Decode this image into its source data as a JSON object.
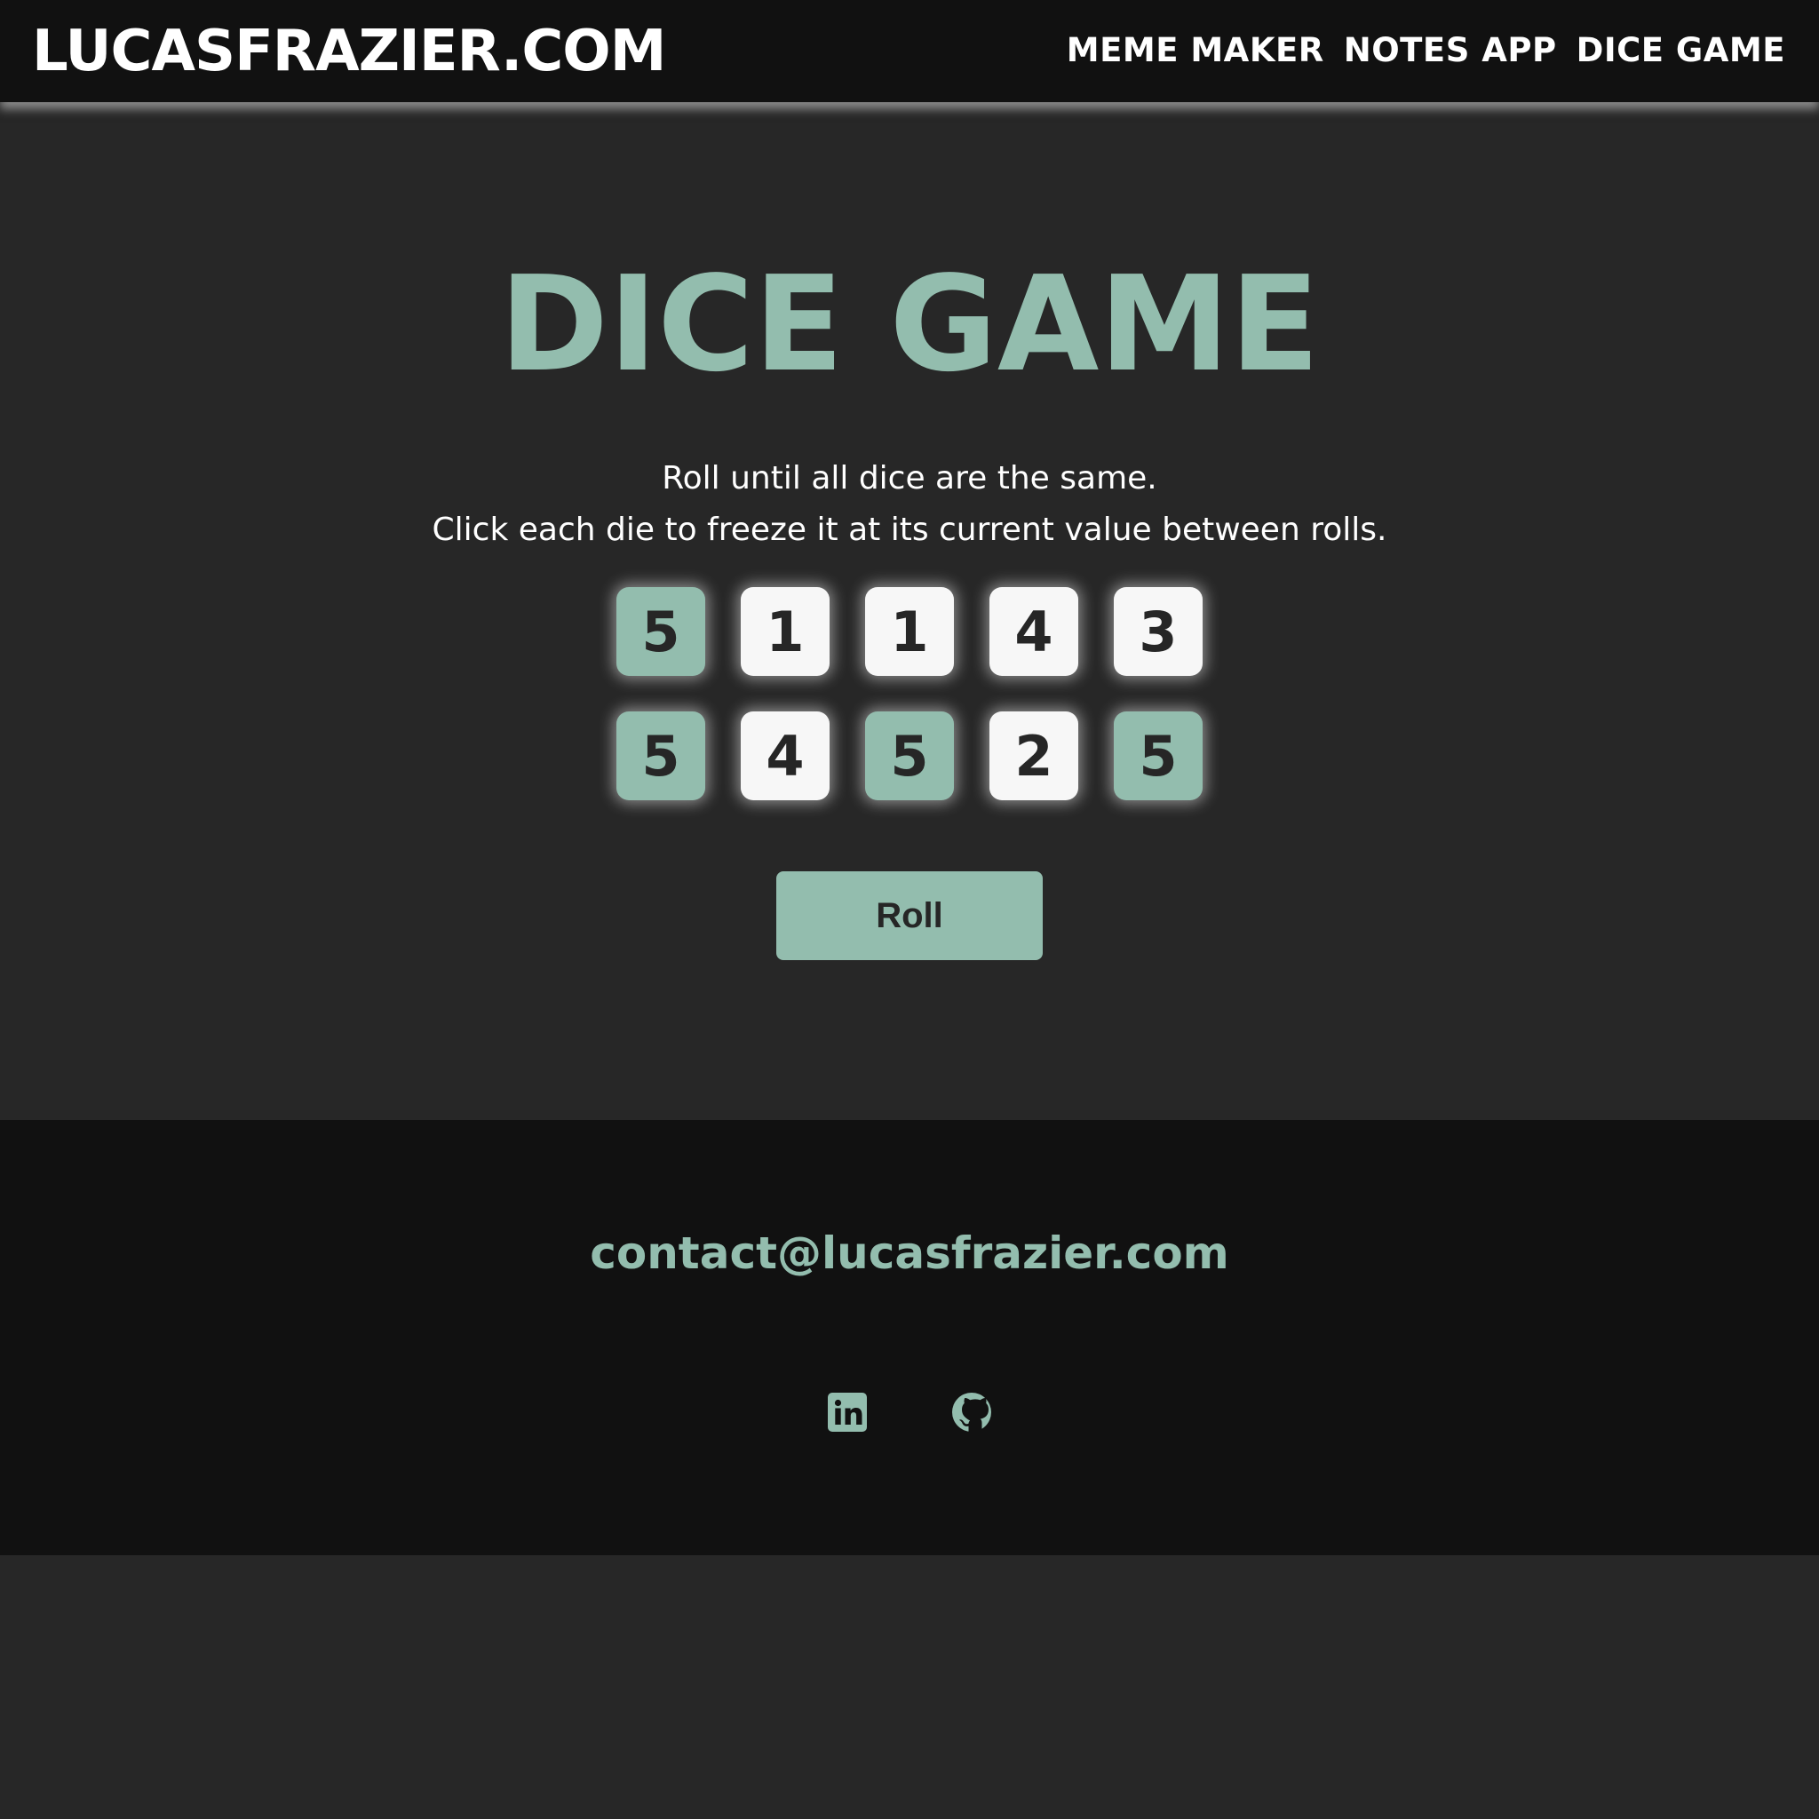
{
  "header": {
    "brand": "LUCASFRAZIER.COM",
    "nav": [
      {
        "label": "MEME MAKER"
      },
      {
        "label": "NOTES APP"
      },
      {
        "label": "DICE GAME"
      }
    ]
  },
  "main": {
    "title": "DICE GAME",
    "instructions": [
      "Roll until all dice are the same.",
      "Click each die to freeze it at its current value between rolls."
    ],
    "dice": [
      {
        "value": "5",
        "held": true
      },
      {
        "value": "1",
        "held": false
      },
      {
        "value": "1",
        "held": false
      },
      {
        "value": "4",
        "held": false
      },
      {
        "value": "3",
        "held": false
      },
      {
        "value": "5",
        "held": true
      },
      {
        "value": "4",
        "held": false
      },
      {
        "value": "5",
        "held": true
      },
      {
        "value": "2",
        "held": false
      },
      {
        "value": "5",
        "held": true
      }
    ],
    "roll_label": "Roll"
  },
  "footer": {
    "email": "contact@lucasfrazier.com",
    "social": [
      {
        "icon": "linkedin-icon"
      },
      {
        "icon": "github-icon"
      }
    ]
  },
  "colors": {
    "accent": "#93bdae",
    "page_background": "#272727",
    "bar_background": "#111111",
    "die_background": "#f7f7f7",
    "dark_text": "#262626"
  }
}
